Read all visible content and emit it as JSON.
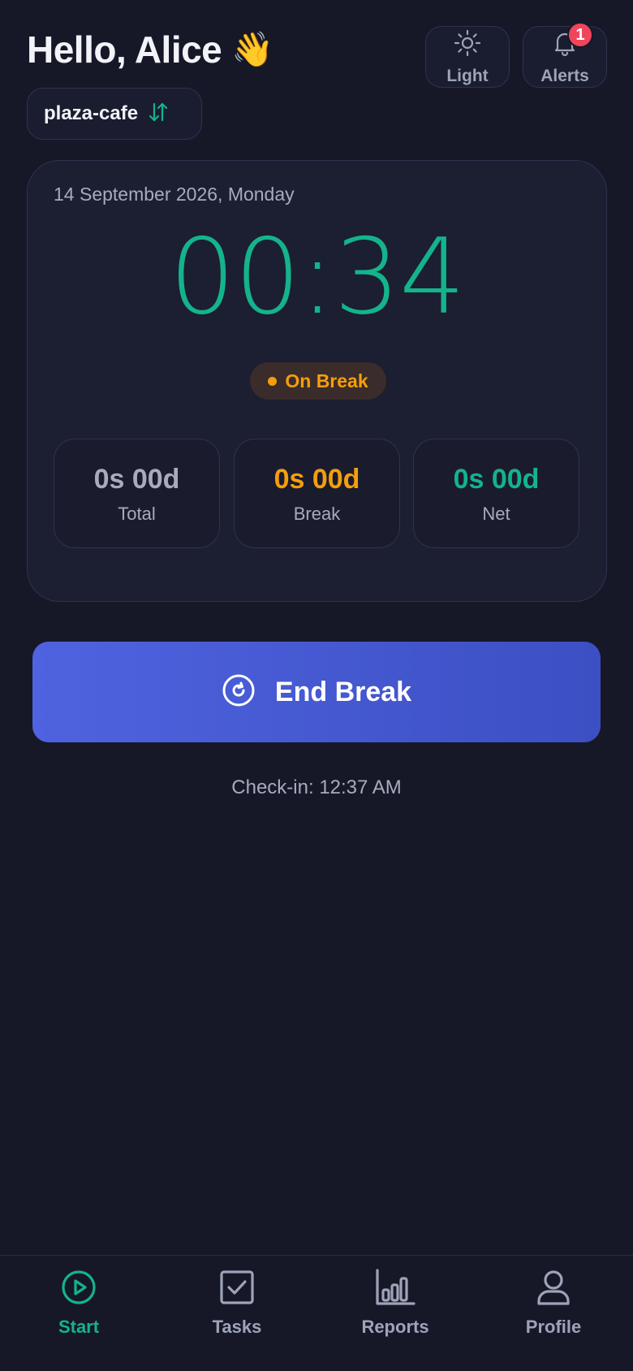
{
  "header": {
    "greeting": "Hello, Alice",
    "wave_emoji": "👋",
    "light_label": "Light",
    "alerts_label": "Alerts",
    "alerts_count": "1",
    "org_name": "plaza-cafe"
  },
  "timer_card": {
    "date": "14 September 2026, Monday",
    "elapsed": "00:34",
    "status": "On Break",
    "stats": {
      "total_value": "0s 00d",
      "total_label": "Total",
      "break_value": "0s 00d",
      "break_label": "Break",
      "net_value": "0s 00d",
      "net_label": "Net"
    }
  },
  "action": {
    "end_break_label": "End Break",
    "checkin_text": "Check-in: 12:37 AM"
  },
  "nav": {
    "start": "Start",
    "tasks": "Tasks",
    "reports": "Reports",
    "profile": "Profile",
    "active": "start"
  },
  "colors": {
    "background": "#161828",
    "card": "#1c1e31",
    "accent_green": "#14b38c",
    "accent_orange": "#f59e0b",
    "primary_button": "#4f63e0",
    "badge": "#f0455a"
  },
  "icons": [
    "sun-icon",
    "bell-icon",
    "swap-arrows-icon",
    "refresh-circle-icon",
    "play-circle-icon",
    "checkbox-icon",
    "bar-chart-icon",
    "user-icon"
  ]
}
